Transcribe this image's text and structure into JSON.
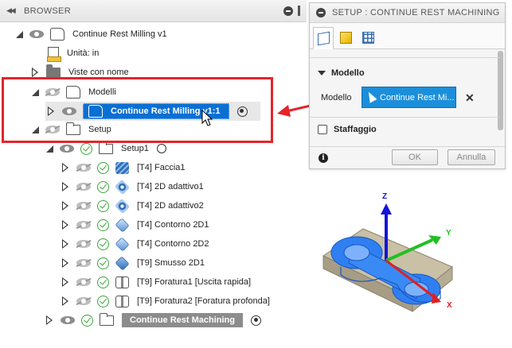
{
  "browser": {
    "collapse_icon": "double-chevron-left-icon",
    "title": "BROWSER"
  },
  "tree": {
    "root_label": "Continue Rest Milling v1",
    "units_label": "Unità: in",
    "named_views_label": "Viste con nome",
    "models_label": "Modelli",
    "model_item_label": "Continue Rest Milling v1:1",
    "setup_folder_label": "Setup",
    "setup1_label": "Setup1",
    "operations": [
      {
        "label": "[T4] Faccia1",
        "tool_icon": "face-icon"
      },
      {
        "label": "[T4] 2D adattivo1",
        "tool_icon": "adaptive-icon"
      },
      {
        "label": "[T4] 2D adattivo2",
        "tool_icon": "adaptive-icon"
      },
      {
        "label": "[T4] Contorno 2D1",
        "tool_icon": "contour-icon"
      },
      {
        "label": "[T4] Contorno 2D2",
        "tool_icon": "contour-icon"
      },
      {
        "label": "[T9] Smusso 2D1",
        "tool_icon": "chamfer-icon"
      },
      {
        "label": "[T9] Foratura1 [Uscita rapida]",
        "tool_icon": "drill-icon"
      },
      {
        "label": "[T9] Foratura2 [Foratura profonda]",
        "tool_icon": "drill-icon"
      }
    ],
    "last_setup_label": "Continue Rest Machining"
  },
  "setup_panel": {
    "title": "SETUP : CONTINUE REST MACHINING",
    "tabs": [
      "setup-tab",
      "stock-tab",
      "post-tab"
    ],
    "model_section": "Modello",
    "model_field_label": "Modello",
    "model_selection": "Continue Rest Mi...",
    "clear_symbol": "✕",
    "fixture_section": "Staffaggio",
    "ok_label": "OK",
    "cancel_label": "Annulla",
    "info_symbol": "i"
  },
  "viewport": {
    "axis_z": "Z",
    "axis_y": "Y",
    "axis_x": "X"
  },
  "colors": {
    "selection_blue": "#0a6fd3",
    "highlight_red": "#e5242b",
    "accent_button": "#1b8fdb",
    "check_green": "#3aa53a"
  }
}
